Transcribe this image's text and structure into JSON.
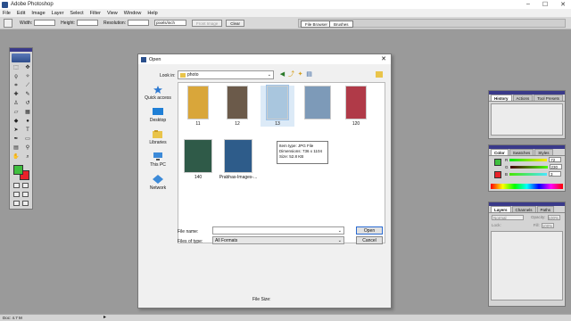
{
  "app": {
    "title": "Adobe Photoshop"
  },
  "menu": [
    "File",
    "Edit",
    "Image",
    "Layer",
    "Select",
    "Filter",
    "View",
    "Window",
    "Help"
  ],
  "options_bar": {
    "width_label": "Width:",
    "height_label": "Height:",
    "resolution_label": "Resolution:",
    "resolution_unit": "pixels/inch",
    "front_image_button": "Front Image",
    "clear_button": "Clear"
  },
  "palette_well": {
    "tabs": [
      "File Browser",
      "Brushes"
    ]
  },
  "dialog": {
    "title": "Open",
    "look_in_label": "Look in:",
    "look_in_value": "photo",
    "places": [
      "Quick access",
      "Desktop",
      "Libraries",
      "This PC",
      "Network"
    ],
    "files": [
      {
        "name": "11",
        "color": "#d9a63a"
      },
      {
        "name": "12",
        "color": "#6b5a4a"
      },
      {
        "name": "13",
        "color": "#a9c6de"
      },
      {
        "name": "",
        "color": "#7d9ab8"
      },
      {
        "name": "120",
        "color": "#b03a48"
      },
      {
        "name": "140",
        "color": "#2f5a48"
      },
      {
        "name": "Prabhas-Images-...",
        "color": "#2e5c8a"
      }
    ],
    "tooltip": {
      "item_type": "Item type: JPG File",
      "dimensions": "Dimensions: 736 x 1104",
      "size": "Size: 52.8 KB"
    },
    "file_name_label": "File name:",
    "file_name_value": "",
    "files_of_type_label": "Files of type:",
    "files_of_type_value": "All Formats",
    "open_button": "Open",
    "cancel_button": "Cancel",
    "file_size_label": "File Size:"
  },
  "history_palette": {
    "tabs": [
      "History",
      "Actions",
      "Tool Presets"
    ]
  },
  "color_palette": {
    "tabs": [
      "Color",
      "Swatches",
      "Styles"
    ],
    "rows": [
      {
        "label": "R",
        "value": "72"
      },
      {
        "label": "G",
        "value": "230"
      },
      {
        "label": "B",
        "value": "3"
      }
    ]
  },
  "layers_palette": {
    "tabs": [
      "Layers",
      "Channels",
      "Paths"
    ],
    "blend_mode": "Normal",
    "opacity_label": "Opacity:",
    "opacity_value": "100%",
    "lock_label": "Lock:",
    "fill_label": "Fill:",
    "fill_value": "100%"
  },
  "status": {
    "doc_info": "Doc: 4.7 M"
  },
  "colors": {
    "foreground": "#3fbf3f",
    "background": "#e8222a"
  }
}
